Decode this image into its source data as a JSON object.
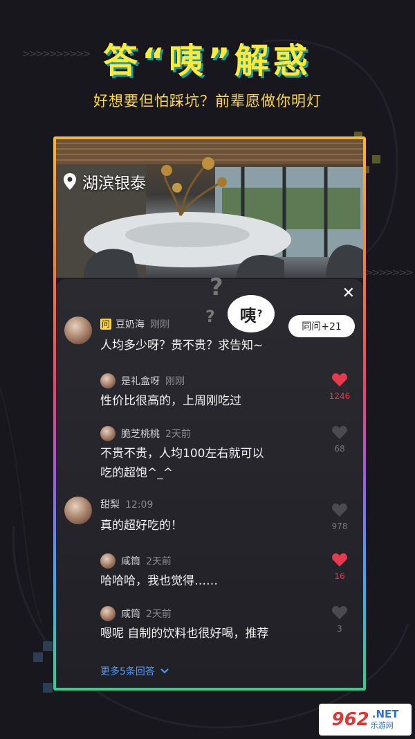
{
  "header": {
    "headline": "答“咦”解惑",
    "subhead": "好想要但怕踩坑？前辈愿做你明灯"
  },
  "card": {
    "location": "湖滨银泰",
    "bubble_text": "咦",
    "bubble_mark": "?",
    "same_question": "同问+21",
    "close": "✕",
    "more_replies": "更多5条回答"
  },
  "question": {
    "badge": "问",
    "user": "豆奶海",
    "time": "刚刚",
    "text": "人均多少呀？贵不贵？求告知~"
  },
  "comments": [
    {
      "user": "是礼盒呀",
      "time": "刚刚",
      "text": "性价比很高的，上周刚吃过",
      "likes": "1246",
      "liked": true
    },
    {
      "user": "脆芝桃桃",
      "time": "2天前",
      "lines": [
        "不贵不贵，人均100左右就可以",
        "吃的超饱^_^"
      ],
      "likes": "68",
      "liked": false
    },
    {
      "user": "甜梨",
      "time": "12:09",
      "text": "真的超好吃的！",
      "likes": "978",
      "liked": false
    },
    {
      "user": "咸筒",
      "time": "2天前",
      "text": "哈哈哈，我也觉得……",
      "likes": "16",
      "liked": true
    },
    {
      "user": "咸筒",
      "time": "2天前",
      "text": "嗯呢 自制的饮料也很好喝，推荐",
      "likes": "3",
      "liked": false
    }
  ],
  "watermark": {
    "number": "962",
    "suffix": ".NET",
    "site": "乐游网"
  },
  "colors": {
    "accent_yellow": "#ffe93b",
    "like_red": "#e83a4f",
    "link_blue": "#4f9ef7"
  }
}
